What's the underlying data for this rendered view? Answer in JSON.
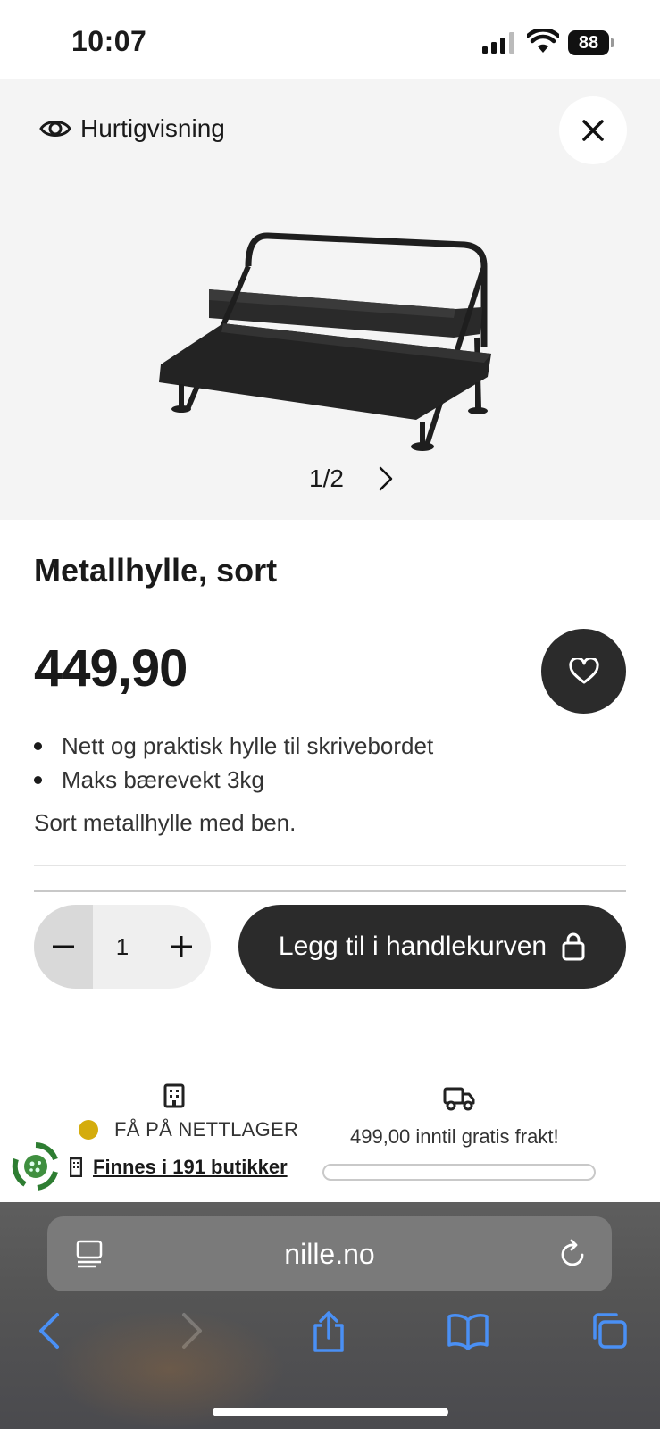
{
  "status_bar": {
    "time": "10:07",
    "battery": "88",
    "icons": [
      "cellular-signal-icon",
      "wifi-icon",
      "battery-icon"
    ]
  },
  "quick_view": {
    "label": "Hurtigvisning",
    "icon": "eye-icon",
    "close_icon": "close-icon",
    "pager": "1/2",
    "next_icon": "chevron-right-icon"
  },
  "product": {
    "title": "Metallhylle, sort",
    "price": "449,90",
    "bullets": [
      "Nett og praktisk hylle til skrivebordet",
      "Maks bærevekt 3kg"
    ],
    "description": "Sort metallhylle med ben.",
    "favorite_icon": "heart-icon"
  },
  "cart": {
    "quantity": "1",
    "add_label": "Legg til i handlekurven",
    "add_icon": "shopping-bag-icon"
  },
  "availability": {
    "online_status": "FÅ PÅ NETTLAGER",
    "status_color": "#d4ac0d",
    "stores_link": "Finnes i 191 butikker"
  },
  "shipping": {
    "text": "499,00 inntil gratis frakt!",
    "progress_fraction": 0
  },
  "browser": {
    "url": "nille.no",
    "toolbar": [
      "back-icon",
      "forward-icon",
      "share-icon",
      "bookmarks-icon",
      "tabs-icon"
    ],
    "accent": "#3b82f6"
  }
}
